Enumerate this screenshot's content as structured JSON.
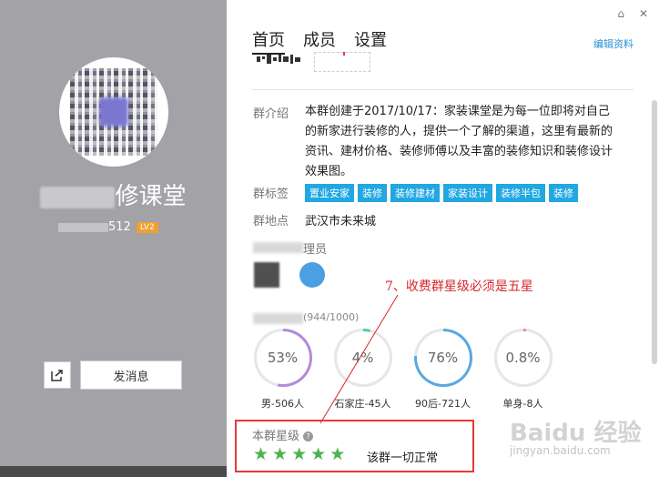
{
  "left": {
    "group_name": "修课堂",
    "group_num": "512",
    "level": "LV2",
    "message_button": "发消息"
  },
  "header": {
    "tabs": [
      "首页",
      "成员",
      "设置"
    ],
    "edit": "编辑资料"
  },
  "info": {
    "intro_label": "群介绍",
    "intro_text": "本群创建于2017/10/17：家装课堂是为每一位即将对自己的新家进行装修的人，提供一个了解的渠道，这里有最新的资讯、建材价格、装修师傅以及丰富的装修知识和装修设计效果图。",
    "tags_label": "群标签",
    "tags": [
      "置业安家",
      "装修",
      "装修建材",
      "家装设计",
      "装修半包",
      "装修"
    ],
    "location_label": "群地点",
    "location": "武汉市未来城",
    "admin_label_tail": "理员",
    "member_count": "(944/1000)"
  },
  "stats": [
    {
      "value": "53%",
      "label": "男-506人",
      "pct": 53,
      "color": "#b48ad6"
    },
    {
      "value": "4%",
      "label": "石家庄-45人",
      "pct": 4,
      "color": "#5bc8a8"
    },
    {
      "value": "76%",
      "label": "90后-721人",
      "pct": 76,
      "color": "#5aa8e0"
    },
    {
      "value": "0.8%",
      "label": "单身-8人",
      "pct": 0.8,
      "color": "#f08aa0"
    }
  ],
  "annotation": "7、收费群星级必须是五星",
  "rating": {
    "title": "本群星级",
    "stars": 5,
    "status": "该群一切正常"
  },
  "watermark": {
    "brand": "Baidu 经验",
    "url": "jingyan.baidu.com"
  }
}
